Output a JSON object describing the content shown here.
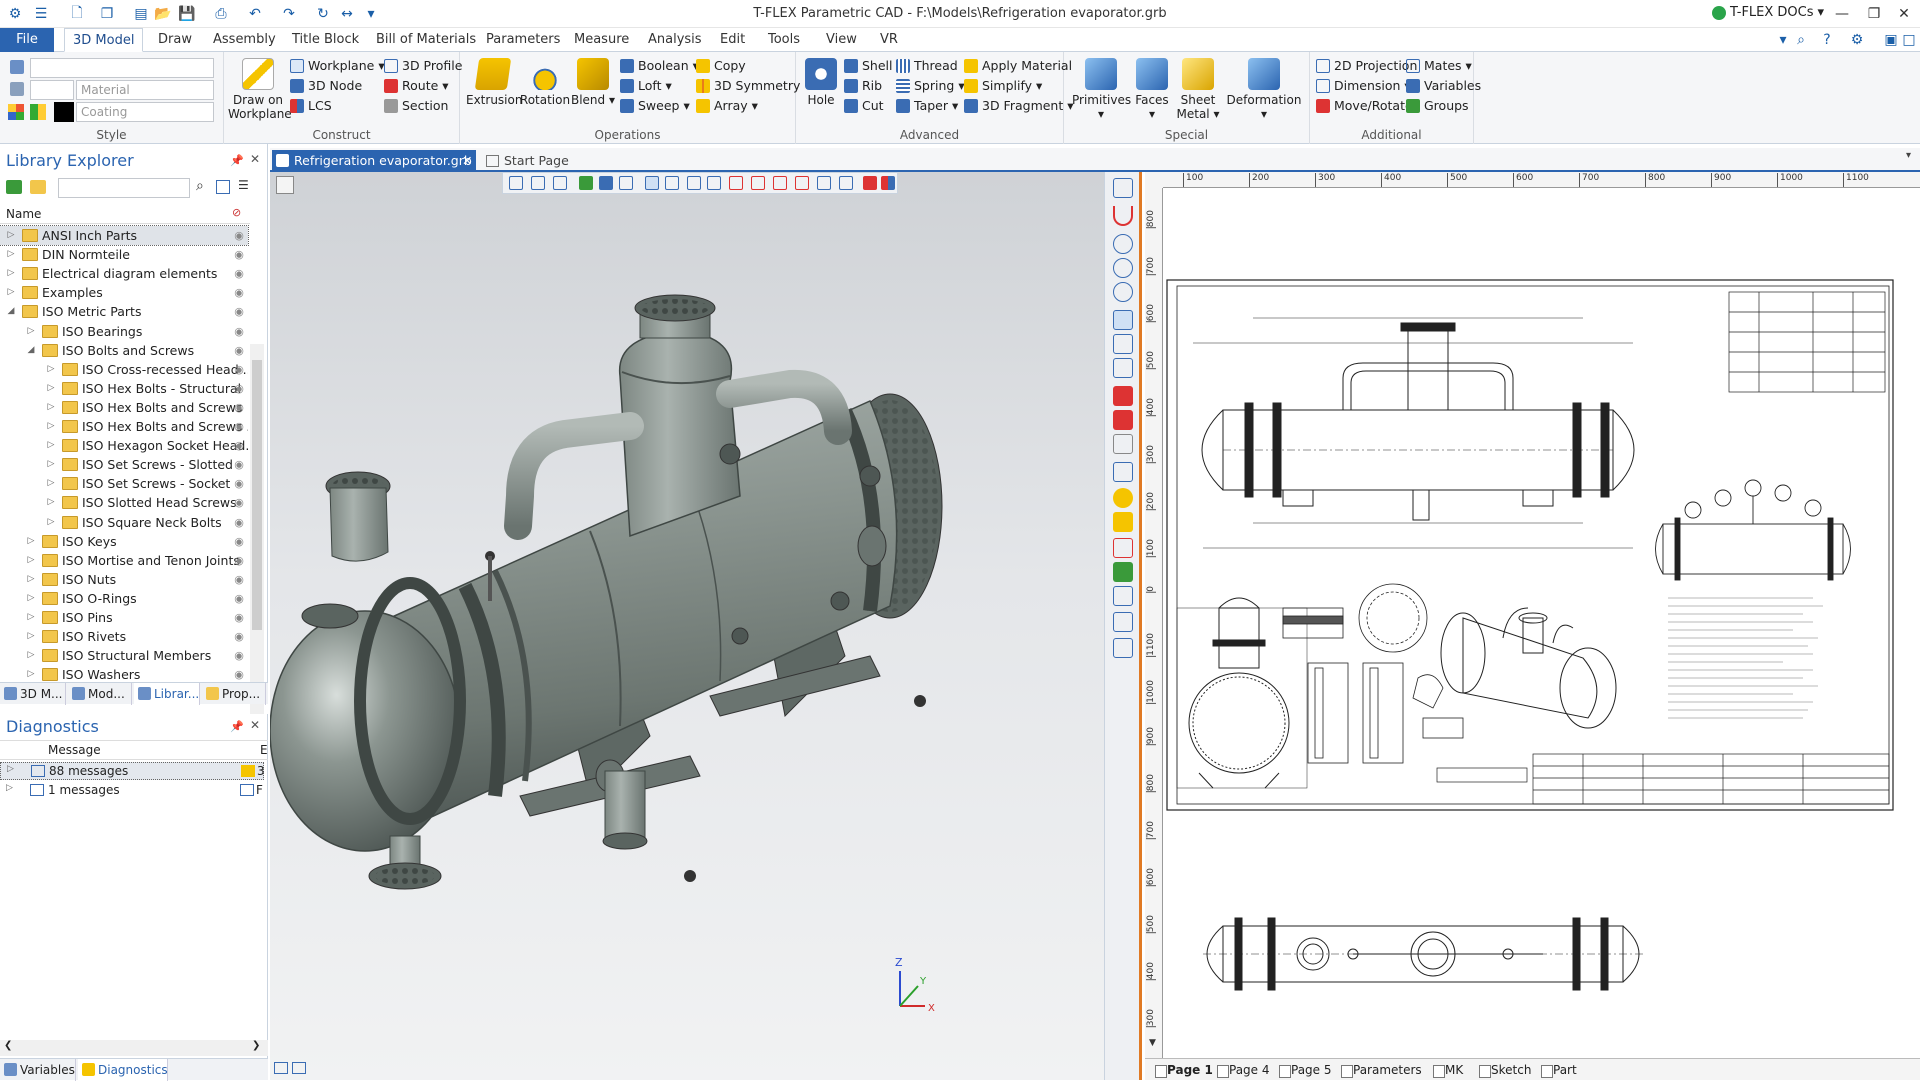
{
  "window": {
    "title": "T-FLEX Parametric CAD - F:\\Models\\Refrigeration evaporator.grb",
    "docs_label": "T-FLEX DOCs"
  },
  "tabs": [
    "File",
    "3D Model",
    "Draw",
    "Assembly",
    "Title Block",
    "Bill of Materials",
    "Parameters",
    "Measure",
    "Analysis",
    "Edit",
    "Tools",
    "View",
    "VR"
  ],
  "ribbon": {
    "style": {
      "label": "Style",
      "material_placeholder": "Material",
      "coating_placeholder": "Coating"
    },
    "construct": {
      "label": "Construct",
      "draw_on_workplane": "Draw on Workplane",
      "workplane": "Workplane",
      "node_3d": "3D Node",
      "lcs": "LCS",
      "profile_3d": "3D Profile",
      "route": "Route",
      "section": "Section"
    },
    "operations": {
      "label": "Operations",
      "extrusion": "Extrusion",
      "rotation": "Rotation",
      "blend": "Blend",
      "boolean": "Boolean",
      "loft": "Loft",
      "sweep": "Sweep",
      "copy": "Copy",
      "symmetry_3d": "3D Symmetry",
      "array": "Array"
    },
    "advanced": {
      "label": "Advanced",
      "hole": "Hole",
      "shell": "Shell",
      "rib": "Rib",
      "cut": "Cut",
      "thread": "Thread",
      "spring": "Spring",
      "taper": "Taper",
      "apply_material": "Apply Material",
      "simplify": "Simplify",
      "fragment_3d": "3D Fragment"
    },
    "special": {
      "label": "Special",
      "primitives": "Primitives",
      "faces": "Faces",
      "sheet_metal": "Sheet Metal",
      "deformation": "Deformation"
    },
    "additional": {
      "label": "Additional",
      "projection_2d": "2D Projection",
      "dimension": "Dimension",
      "move_rotate": "Move/Rotate",
      "mates": "Mates",
      "variables": "Variables",
      "groups": "Groups"
    }
  },
  "library": {
    "title": "Library Explorer",
    "column_name": "Name",
    "items": [
      {
        "label": "ANSI Inch Parts",
        "level": 0,
        "exp": "+"
      },
      {
        "label": "DIN Normteile",
        "level": 0,
        "exp": "+"
      },
      {
        "label": "Electrical diagram elements",
        "level": 0,
        "exp": "+"
      },
      {
        "label": "Examples",
        "level": 0,
        "exp": "+"
      },
      {
        "label": "ISO Metric Parts",
        "level": 0,
        "exp": "-"
      },
      {
        "label": "ISO Bearings",
        "level": 1,
        "exp": "+"
      },
      {
        "label": "ISO Bolts and Screws",
        "level": 1,
        "exp": "-"
      },
      {
        "label": "ISO Cross-recessed Head ...",
        "level": 2,
        "exp": "+"
      },
      {
        "label": "ISO Hex Bolts - Structural",
        "level": 2,
        "exp": "+"
      },
      {
        "label": "ISO Hex Bolts and Screws",
        "level": 2,
        "exp": "+"
      },
      {
        "label": "ISO Hex Bolts and Screws ...",
        "level": 2,
        "exp": "+"
      },
      {
        "label": "ISO Hexagon Socket Head...",
        "level": 2,
        "exp": "+"
      },
      {
        "label": "ISO Set Screws - Slotted",
        "level": 2,
        "exp": "+"
      },
      {
        "label": "ISO Set Screws - Socket",
        "level": 2,
        "exp": "+"
      },
      {
        "label": "ISO Slotted Head Screws",
        "level": 2,
        "exp": "+"
      },
      {
        "label": "ISO Square Neck Bolts",
        "level": 2,
        "exp": "+"
      },
      {
        "label": "ISO Keys",
        "level": 1,
        "exp": "+"
      },
      {
        "label": "ISO Mortise and Tenon Joints",
        "level": 1,
        "exp": "+"
      },
      {
        "label": "ISO Nuts",
        "level": 1,
        "exp": "+"
      },
      {
        "label": "ISO O-Rings",
        "level": 1,
        "exp": "+"
      },
      {
        "label": "ISO Pins",
        "level": 1,
        "exp": "+"
      },
      {
        "label": "ISO Rivets",
        "level": 1,
        "exp": "+"
      },
      {
        "label": "ISO Structural Members",
        "level": 1,
        "exp": "+"
      },
      {
        "label": "ISO Washers",
        "level": 1,
        "exp": "+"
      }
    ]
  },
  "bottom_tabs": [
    "3D M...",
    "Mod...",
    "Librar...",
    "Prop..."
  ],
  "diagnostics": {
    "title": "Diagnostics",
    "column_message": "Message",
    "rows": [
      {
        "label": "88 messages",
        "count": "3"
      },
      {
        "label": "1 messages",
        "count": "F"
      }
    ]
  },
  "status_tabs": [
    "Variables",
    "Diagnostics"
  ],
  "doc_tabs": [
    "Refrigeration evaporator.grb",
    "Start Page"
  ],
  "ruler": {
    "h_ticks": [
      "100",
      "200",
      "300",
      "400",
      "500",
      "600",
      "700",
      "800",
      "900",
      "1000",
      "1100"
    ],
    "v_ticks": [
      "800",
      "700",
      "600",
      "500",
      "400",
      "300",
      "200",
      "100",
      "0",
      "1100",
      "1000",
      "900",
      "800",
      "700",
      "600",
      "500",
      "400",
      "300"
    ]
  },
  "page_tabs": [
    "Page 1",
    "Page 4",
    "Page 5",
    "Parameters",
    "MK",
    "Sketch",
    "Part"
  ],
  "axis": {
    "z": "Z",
    "y": "Y",
    "x": "X"
  },
  "colors": {
    "accent": "#2b64b0",
    "model": "#7f8a86",
    "active_border": "#e07a24"
  }
}
